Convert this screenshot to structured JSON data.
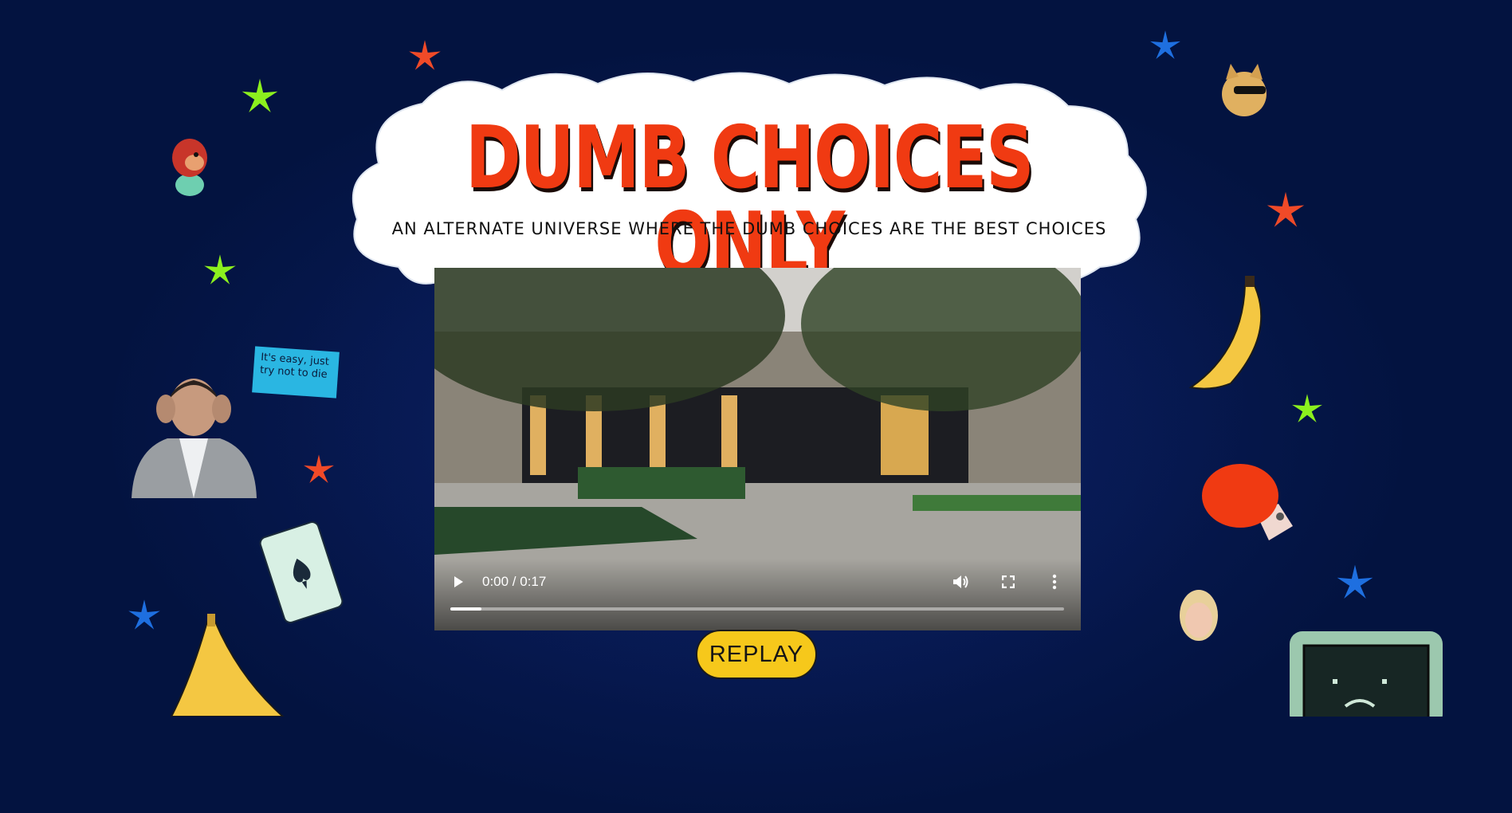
{
  "header": {
    "title": "DUMB CHOICES ONLY",
    "subtitle": "AN ALTERNATE UNIVERSE WHERE THE DUMB CHOICES ARE THE BEST CHOICES"
  },
  "video": {
    "time_display": "0:00 / 0:17",
    "progress": 0.05,
    "icons": [
      "play-icon",
      "volume-icon",
      "fullscreen-icon",
      "more-options-icon"
    ]
  },
  "replay_button": {
    "label": "REPLAY"
  },
  "speech_bubble": {
    "text": "It's easy, just try not to die"
  },
  "colors": {
    "background": "#031340",
    "title_red": "#f03a12",
    "replay_yellow": "#f6c81b",
    "star_green": "#8cf01e",
    "star_orange": "#f04a28",
    "star_blue": "#1e6fe0"
  }
}
